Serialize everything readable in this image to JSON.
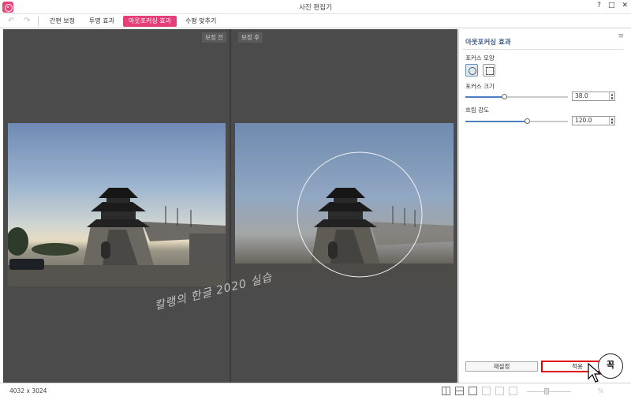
{
  "window": {
    "title": "사진 편집기",
    "help": "?",
    "controls": [
      "□",
      "✕"
    ]
  },
  "toolbar": {
    "undo_icon": "↶",
    "redo_icon": "↷",
    "tabs": [
      {
        "label": "간편 보정",
        "active": false
      },
      {
        "label": "투명 효과",
        "active": false
      },
      {
        "label": "아웃포커싱 효과",
        "active": true
      },
      {
        "label": "수평 맞추기",
        "active": false
      }
    ]
  },
  "canvas": {
    "before_label": "보정 전",
    "after_label": "보정 후",
    "watermark": "칼랭의 한글 2020 실습"
  },
  "panel": {
    "title": "아웃포커싱 효과",
    "menu_icon": "≡",
    "focus_shape_label": "포커스 모양",
    "focus_size_label": "포커스 크기",
    "focus_size_value": "38.0",
    "focus_size_fraction": 0.38,
    "blur_label": "흐림 강도",
    "blur_value": "120.0",
    "blur_fraction": 0.6,
    "reset_label": "재설정",
    "apply_label": "적용",
    "badge_text": "꼭"
  },
  "status": {
    "dimensions": "4032 x 3024",
    "zoom": "%"
  },
  "colors": {
    "accent": "#e53e79",
    "panel_title": "#3a5a8c",
    "highlight": "#e00000"
  }
}
